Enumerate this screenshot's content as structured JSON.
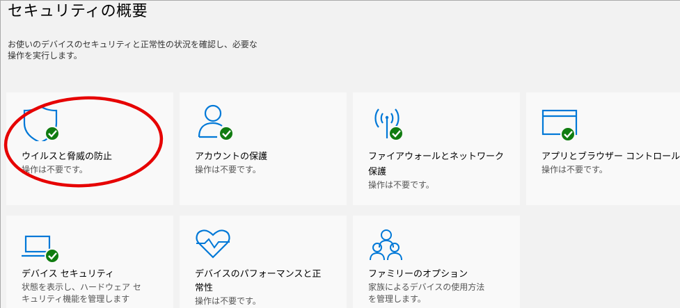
{
  "header": {
    "title": "セキュリティの概要",
    "description_line1": "お使いのデバイスのセキュリティと正常性の状況を確認し、必要な",
    "description_line2": "操作を実行します。"
  },
  "colors": {
    "accent_blue": "#0078d7",
    "status_green": "#107c10",
    "annotation_red": "#e60000"
  },
  "tiles": [
    {
      "icon": "shield-icon",
      "title_line1": "ウイルスと脅威の防止",
      "title_line2": "",
      "status_line1": "操作は不要です。",
      "status_line2": ""
    },
    {
      "icon": "person-icon",
      "title_line1": "アカウントの保護",
      "title_line2": "",
      "status_line1": "操作は不要です。",
      "status_line2": ""
    },
    {
      "icon": "wifi-antenna-icon",
      "title_line1": "ファイアウォールとネットワーク",
      "title_line2": "保護",
      "status_line1": "操作は不要です。",
      "status_line2": ""
    },
    {
      "icon": "browser-window-icon",
      "title_line1": "アプリとブラウザー コントロール",
      "title_line2": "",
      "status_line1": "操作は不要です。",
      "status_line2": ""
    },
    {
      "icon": "laptop-icon",
      "title_line1": "デバイス セキュリティ",
      "title_line2": "",
      "status_line1": "状態を表示し、ハードウェア セ",
      "status_line2": "キュリティ機能を管理します"
    },
    {
      "icon": "heart-pulse-icon",
      "title_line1": "デバイスのパフォーマンスと正",
      "title_line2": "常性",
      "status_line1": "操作は不要です。",
      "status_line2": ""
    },
    {
      "icon": "family-icon",
      "title_line1": "ファミリーのオプション",
      "title_line2": "",
      "status_line1": "家族によるデバイスの使用方法",
      "status_line2": "を管理します。"
    }
  ]
}
